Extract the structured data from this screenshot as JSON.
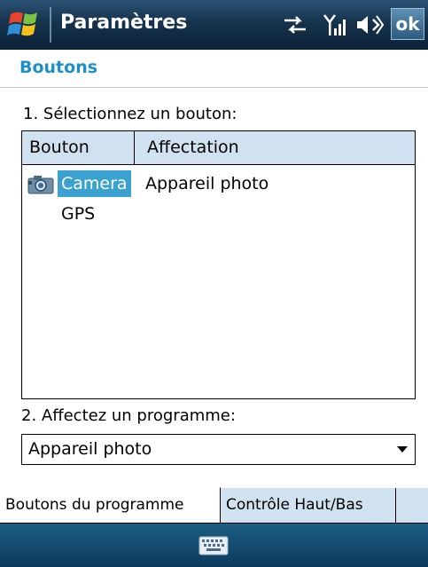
{
  "titlebar": {
    "title": "Paramètres",
    "ok_label": "ok"
  },
  "header": {
    "heading": "Boutons"
  },
  "step1": {
    "label": "1. Sélectionnez un bouton:"
  },
  "listview": {
    "columns": [
      "Bouton",
      "Affectation"
    ],
    "rows": [
      {
        "name": "Camera",
        "assignment": "Appareil photo",
        "selected": true
      },
      {
        "name": "GPS",
        "assignment": "",
        "selected": false
      }
    ]
  },
  "step2": {
    "label": "2. Affectez un programme:",
    "selected_value": "Appareil photo"
  },
  "tabs": [
    {
      "label": "Boutons du programme",
      "active": true
    },
    {
      "label": "Contrôle Haut/Bas",
      "active": false
    }
  ],
  "colors": {
    "accent": "#1e8fc8",
    "selection": "#3aa1d1",
    "header_bg": "#d0e2ef",
    "titlebar": "#16334d"
  },
  "icons": {
    "start": "windows-flag-icon",
    "status": [
      "connectivity-icon",
      "signal-strength-icon",
      "speaker-icon"
    ],
    "row_icon": "camera-icon",
    "menubar": "keyboard-icon"
  }
}
